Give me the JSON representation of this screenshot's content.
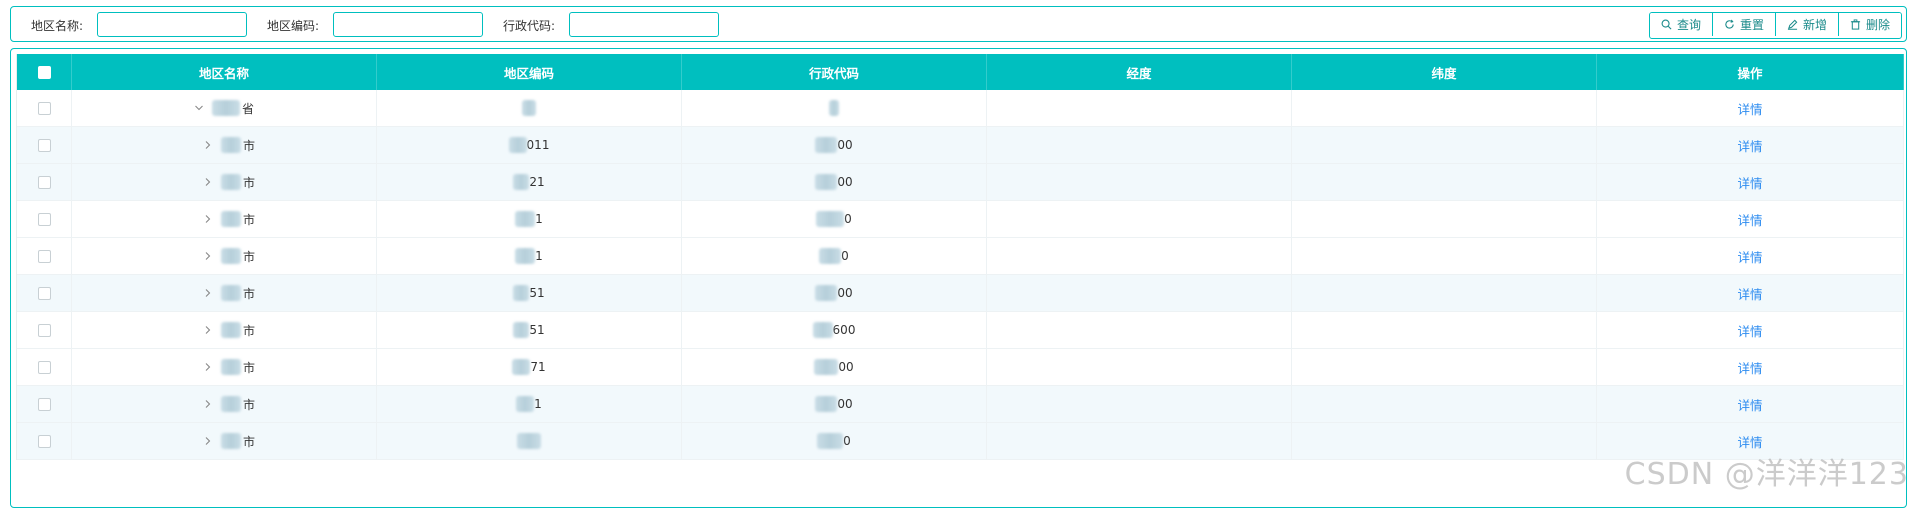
{
  "filters": {
    "region_name_label": "地区名称:",
    "region_code_label": "地区编码:",
    "admin_code_label": "行政代码:",
    "region_name_value": "",
    "region_code_value": "",
    "admin_code_value": ""
  },
  "buttons": {
    "query": "查询",
    "reset": "重置",
    "add": "新增",
    "delete": "删除"
  },
  "table": {
    "headers": {
      "name": "地区名称",
      "code": "地区编码",
      "admin_code": "行政代码",
      "longitude": "经度",
      "latitude": "纬度",
      "actions": "操作"
    },
    "rows": [
      {
        "name": "省",
        "code": "",
        "admin_code": "",
        "longitude": "",
        "latitude": "",
        "action": "详情",
        "expanded": true
      },
      {
        "name": "市",
        "code": "011",
        "admin_code": "00",
        "longitude": "",
        "latitude": "",
        "action": "详情",
        "expanded": false
      },
      {
        "name": "市",
        "code": "21",
        "admin_code": "00",
        "longitude": "",
        "latitude": "",
        "action": "详情",
        "expanded": false
      },
      {
        "name": "市",
        "code": "1",
        "admin_code": "0",
        "longitude": "",
        "latitude": "",
        "action": "详情",
        "expanded": false
      },
      {
        "name": "市",
        "code": "1",
        "admin_code": "0",
        "longitude": "",
        "latitude": "",
        "action": "详情",
        "expanded": false
      },
      {
        "name": "市",
        "code": "51",
        "admin_code": "00",
        "longitude": "",
        "latitude": "",
        "action": "详情",
        "expanded": false
      },
      {
        "name": "市",
        "code": "51",
        "admin_code": "600",
        "longitude": "",
        "latitude": "",
        "action": "详情",
        "expanded": false
      },
      {
        "name": "市",
        "code": "71",
        "admin_code": "00",
        "longitude": "",
        "latitude": "",
        "action": "详情",
        "expanded": false
      },
      {
        "name": "市",
        "code": "1",
        "admin_code": "00",
        "longitude": "",
        "latitude": "",
        "action": "详情",
        "expanded": false
      },
      {
        "name": "市",
        "code": "",
        "admin_code": "0",
        "longitude": "",
        "latitude": "",
        "action": "详情",
        "expanded": false
      }
    ]
  },
  "watermark": "CSDN @洋洋洋123",
  "colors": {
    "accent": "#00bfbf",
    "link": "#2d8cf0",
    "row_alt": "#f2f9fc"
  }
}
